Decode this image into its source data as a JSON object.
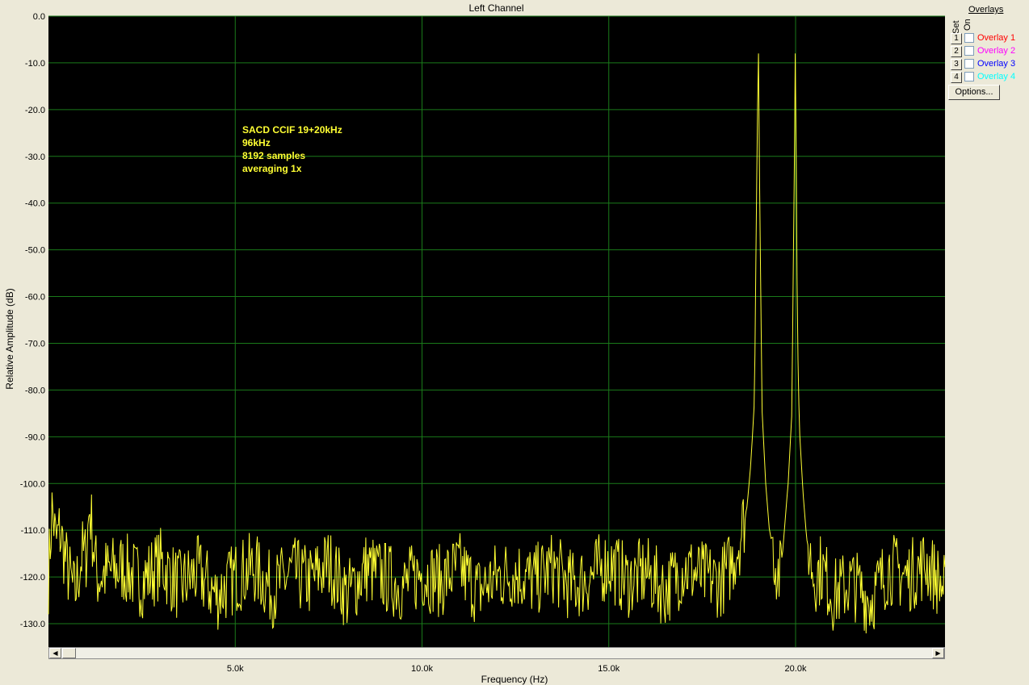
{
  "window": {
    "title": "Left Channel"
  },
  "annotation": [
    "SACD CCIF 19+20kHz",
    "96kHz",
    "8192 samples",
    "averaging 1x"
  ],
  "overlays": {
    "title": "Overlays",
    "set_label": "Set",
    "on_label": "On",
    "items": [
      {
        "num": "1",
        "label": "Overlay 1",
        "color": "#ff0000",
        "checked": false
      },
      {
        "num": "2",
        "label": "Overlay 2",
        "color": "#ff00ff",
        "checked": false
      },
      {
        "num": "3",
        "label": "Overlay 3",
        "color": "#0000ff",
        "checked": false
      },
      {
        "num": "4",
        "label": "Overlay 4",
        "color": "#00ffff",
        "checked": false
      }
    ],
    "options_label": "Options..."
  },
  "scrollbar": {
    "left_icon": "arrow-left-icon",
    "right_icon": "arrow-right-icon"
  },
  "chart_data": {
    "type": "line",
    "xlabel": "Frequency (Hz)",
    "ylabel": "Relative Amplitude (dB)",
    "xlim": [
      0,
      24000
    ],
    "ylim": [
      -135,
      0
    ],
    "x_ticks": [
      5000,
      10000,
      15000,
      20000
    ],
    "x_tick_labels": [
      "5.0k",
      "10.0k",
      "15.0k",
      "20.0k"
    ],
    "y_ticks": [
      0,
      -10,
      -20,
      -30,
      -40,
      -50,
      -60,
      -70,
      -80,
      -90,
      -100,
      -110,
      -120,
      -130
    ],
    "y_tick_labels": [
      "0.0",
      "-10.0",
      "-20.0",
      "-30.0",
      "-40.0",
      "-50.0",
      "-60.0",
      "-70.0",
      "-80.0",
      "-90.0",
      "-100.0",
      "-110.0",
      "-120.0",
      "-130.0"
    ],
    "grid": true,
    "colors": {
      "background": "#000000",
      "grid": "#1a7a1a",
      "trace": "#ffff33"
    },
    "series": [
      {
        "x": [
          0,
          100,
          200,
          300,
          500,
          700,
          900,
          1000,
          1100,
          1300,
          1600,
          2000,
          2500,
          3000,
          3500,
          4000,
          4500,
          5000,
          5500,
          6000,
          6500,
          7000,
          7500,
          8000,
          8500,
          9000,
          9500,
          10000,
          10500,
          11000,
          11500,
          12000,
          12500,
          13000,
          13500,
          14000,
          14500,
          15000,
          15500,
          16000,
          16500,
          17000,
          17500,
          18000,
          18300,
          18500,
          18700,
          18800,
          18900,
          18950,
          19000,
          19050,
          19100,
          19200,
          19300,
          19500,
          19600,
          19700,
          19800,
          19900,
          19950,
          20000,
          20050,
          20100,
          20200,
          20300,
          20500,
          20700,
          21000,
          21500,
          22000,
          22500,
          23000,
          23500,
          24000
        ],
        "y": [
          -120,
          -105,
          -113,
          -110,
          -118,
          -124,
          -115,
          -116,
          -105,
          -120,
          -119,
          -118,
          -121,
          -117,
          -122,
          -119,
          -124,
          -120,
          -118,
          -123,
          -119,
          -121,
          -117,
          -124,
          -118,
          -120,
          -122,
          -119,
          -121,
          -118,
          -123,
          -120,
          -119,
          -121,
          -118,
          -122,
          -120,
          -117,
          -121,
          -119,
          -123,
          -118,
          -120,
          -121,
          -117,
          -112,
          -105,
          -96,
          -82,
          -42,
          -8,
          -45,
          -84,
          -100,
          -110,
          -118,
          -120,
          -110,
          -100,
          -85,
          -45,
          -8,
          -68,
          -88,
          -102,
          -112,
          -120,
          -118,
          -124,
          -121,
          -125,
          -118,
          -120,
          -117,
          -123
        ]
      }
    ]
  }
}
